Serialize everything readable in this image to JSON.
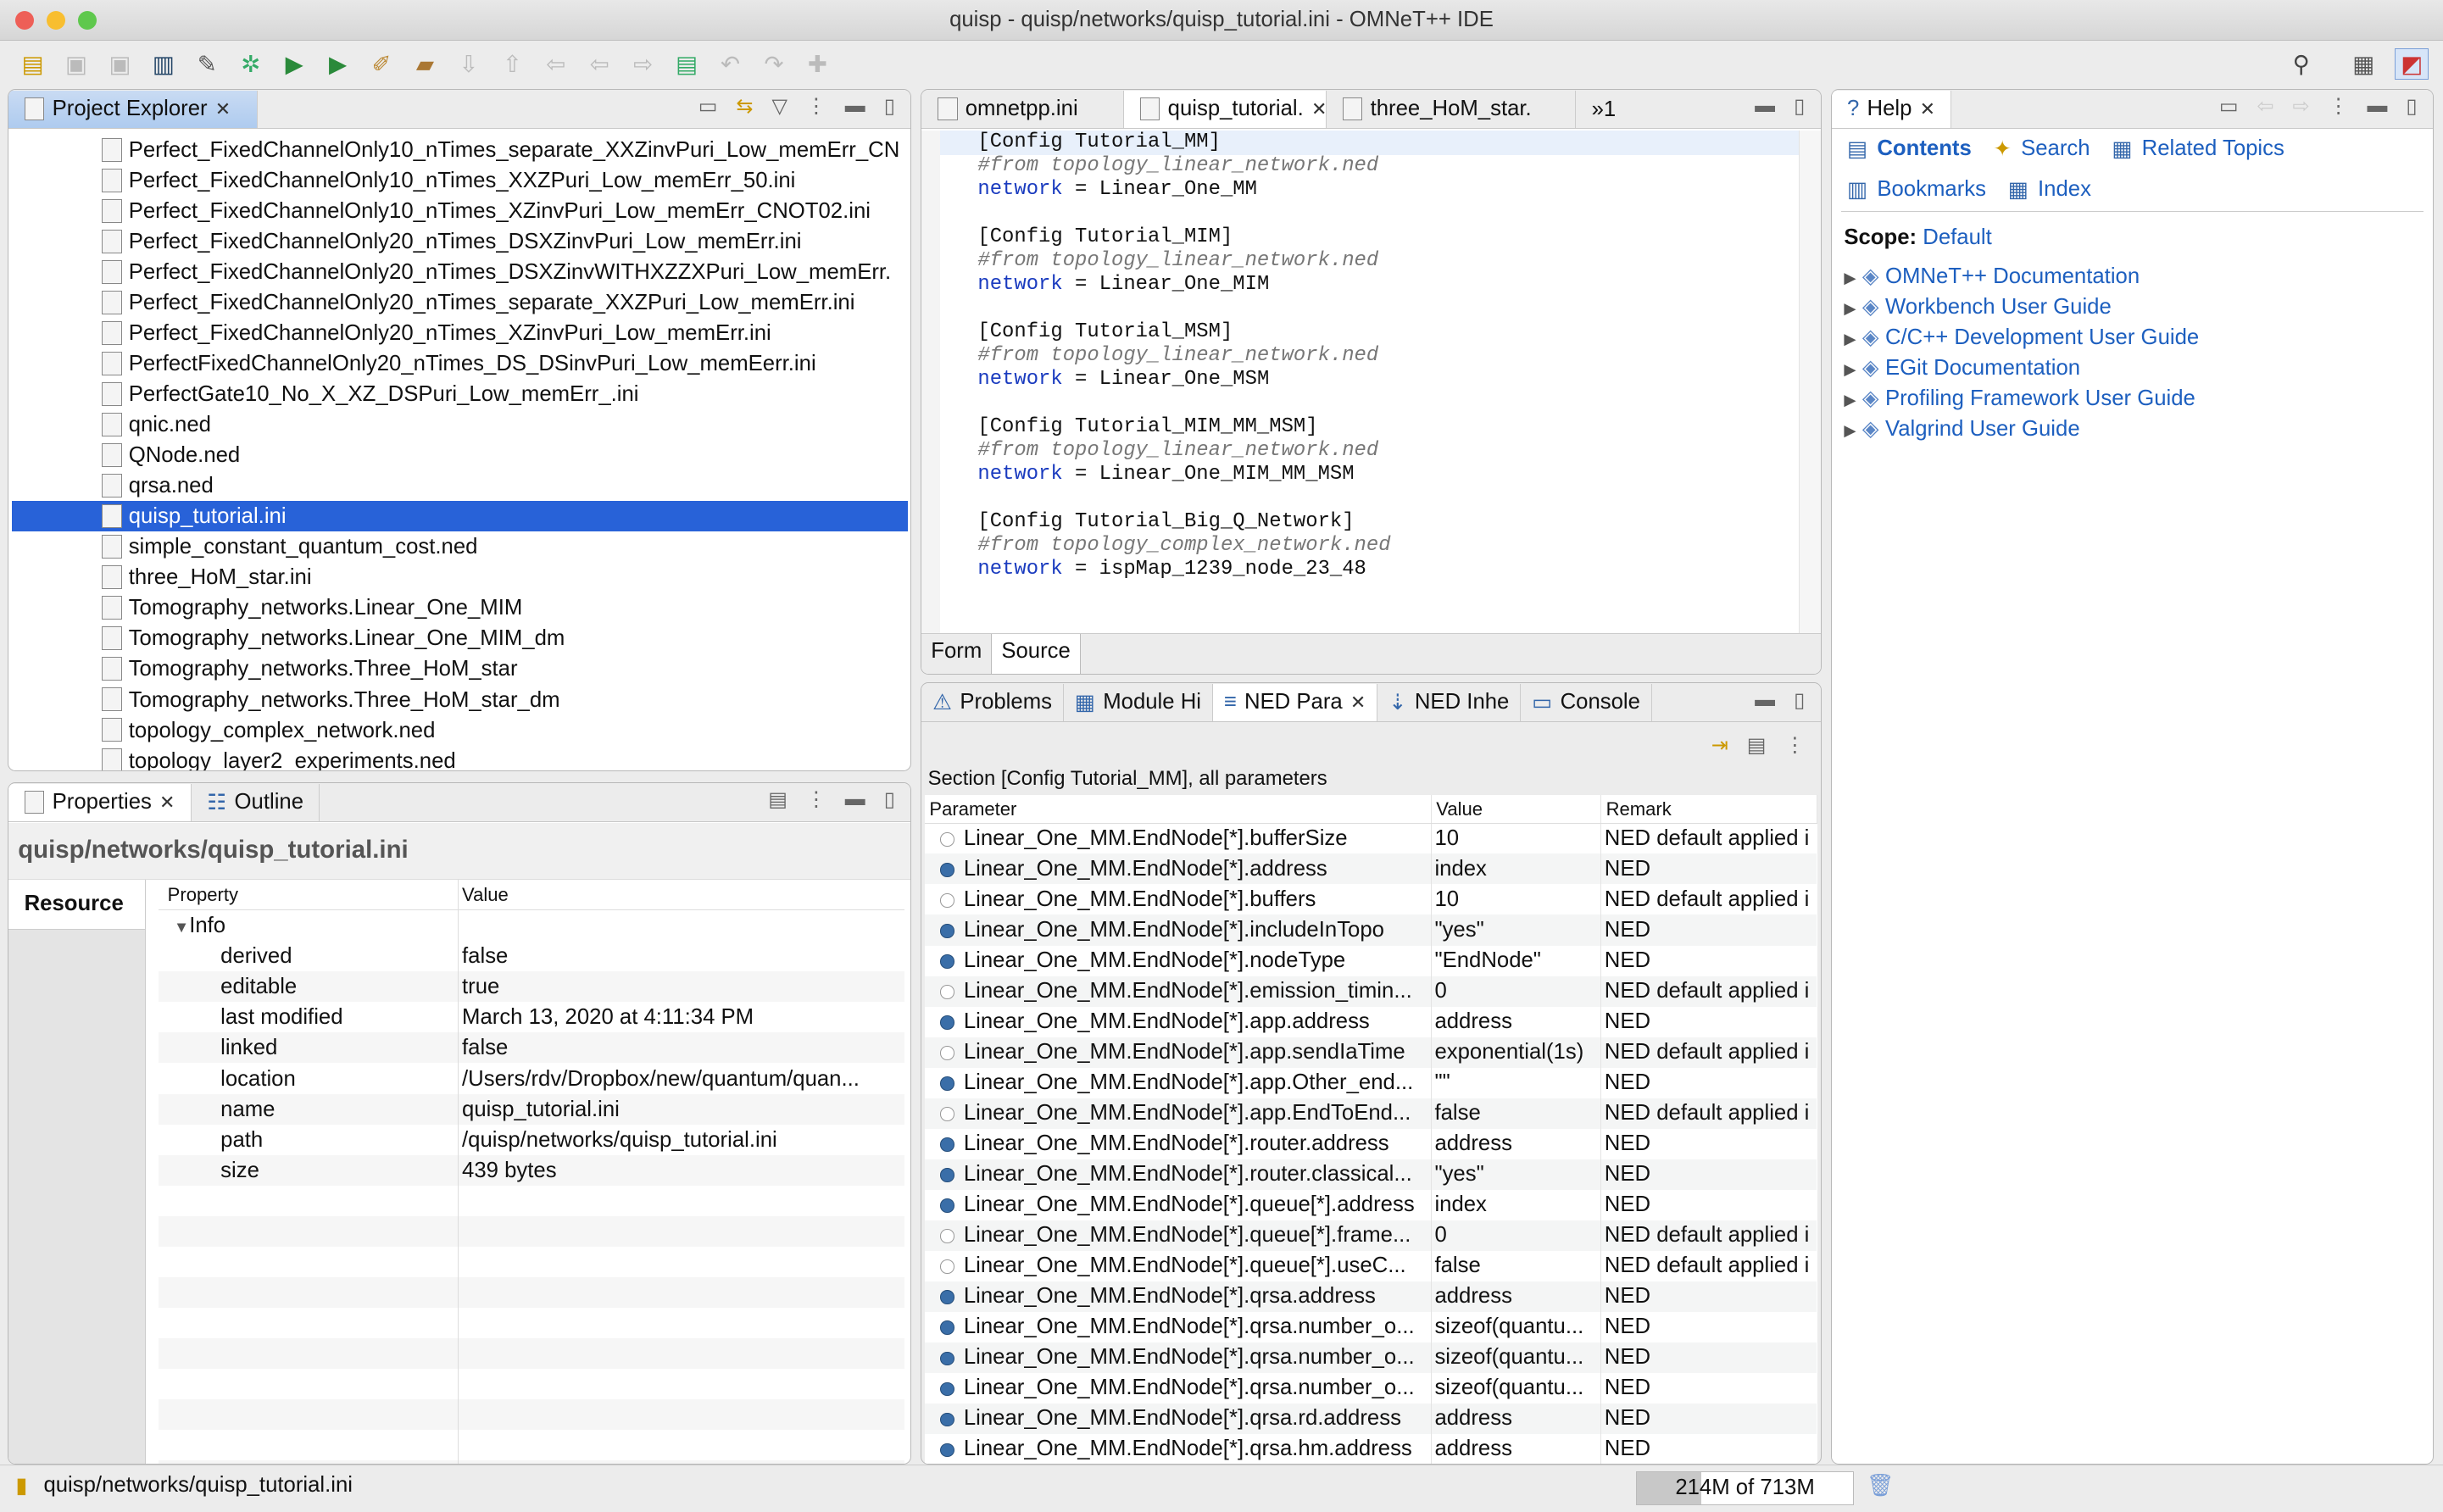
{
  "window": {
    "title": "quisp - quisp/networks/quisp_tutorial.ini - OMNeT++ IDE"
  },
  "project_explorer": {
    "tab": "Project Explorer",
    "items": [
      "Perfect_FixedChannelOnly10_nTimes_separate_XXZinvPuri_Low_memErr_CN",
      "Perfect_FixedChannelOnly10_nTimes_XXZPuri_Low_memErr_50.ini",
      "Perfect_FixedChannelOnly10_nTimes_XZinvPuri_Low_memErr_CNOT02.ini",
      "Perfect_FixedChannelOnly20_nTimes_DSXZinvPuri_Low_memErr.ini",
      "Perfect_FixedChannelOnly20_nTimes_DSXZinvWITHXZZXPuri_Low_memErr.",
      "Perfect_FixedChannelOnly20_nTimes_separate_XXZPuri_Low_memErr.ini",
      "Perfect_FixedChannelOnly20_nTimes_XZinvPuri_Low_memErr.ini",
      "PerfectFixedChannelOnly20_nTimes_DS_DSinvPuri_Low_memEerr.ini",
      "PerfectGate10_No_X_XZ_DSPuri_Low_memErr_.ini",
      "qnic.ned",
      "QNode.ned",
      "qrsa.ned",
      "quisp_tutorial.ini",
      "simple_constant_quantum_cost.ned",
      "three_HoM_star.ini",
      "Tomography_networks.Linear_One_MIM",
      "Tomography_networks.Linear_One_MIM_dm",
      "Tomography_networks.Three_HoM_star",
      "Tomography_networks.Three_HoM_star_dm",
      "topology_complex_network.ned",
      "topology_layer2_experiments.ned"
    ],
    "selected": "quisp_tutorial.ini"
  },
  "properties": {
    "tab": "Properties",
    "outline_tab": "Outline",
    "path_title": "quisp/networks/quisp_tutorial.ini",
    "side_tab": "Resource",
    "col_property": "Property",
    "col_value": "Value",
    "group": "Info",
    "rows": [
      [
        "derived",
        "false"
      ],
      [
        "editable",
        "true"
      ],
      [
        "last modified",
        "March 13, 2020 at 4:11:34 PM"
      ],
      [
        "linked",
        "false"
      ],
      [
        "location",
        "/Users/rdv/Dropbox/new/quantum/quan..."
      ],
      [
        "name",
        "quisp_tutorial.ini"
      ],
      [
        "path",
        "/quisp/networks/quisp_tutorial.ini"
      ],
      [
        "size",
        "439  bytes"
      ]
    ]
  },
  "editor": {
    "tabs": [
      "omnetpp.ini",
      "quisp_tutorial.",
      "three_HoM_star."
    ],
    "overflow": "»1",
    "bottom_tabs": [
      "Form",
      "Source"
    ],
    "lines": [
      {
        "t": "plain",
        "s": "[Config Tutorial_MM]"
      },
      {
        "t": "cm",
        "s": "#from topology_linear_network.ned"
      },
      {
        "t": "kv",
        "k": "network",
        "s": " = Linear_One_MM"
      },
      {
        "t": "plain",
        "s": ""
      },
      {
        "t": "plain",
        "s": "[Config Tutorial_MIM]"
      },
      {
        "t": "cm",
        "s": "#from topology_linear_network.ned"
      },
      {
        "t": "kv",
        "k": "network",
        "s": " = Linear_One_MIM"
      },
      {
        "t": "plain",
        "s": ""
      },
      {
        "t": "plain",
        "s": "[Config Tutorial_MSM]"
      },
      {
        "t": "cm",
        "s": "#from topology_linear_network.ned"
      },
      {
        "t": "kv",
        "k": "network",
        "s": " = Linear_One_MSM"
      },
      {
        "t": "plain",
        "s": ""
      },
      {
        "t": "plain",
        "s": "[Config Tutorial_MIM_MM_MSM]"
      },
      {
        "t": "cm",
        "s": "#from topology_linear_network.ned"
      },
      {
        "t": "kv",
        "k": "network",
        "s": " = Linear_One_MIM_MM_MSM"
      },
      {
        "t": "plain",
        "s": ""
      },
      {
        "t": "plain",
        "s": "[Config Tutorial_Big_Q_Network]"
      },
      {
        "t": "cm",
        "s": "#from topology_complex_network.ned"
      },
      {
        "t": "kv",
        "k": "network",
        "s": " = ispMap_1239_node_23_48"
      }
    ]
  },
  "bottom": {
    "tabs": [
      "Problems",
      "Module Hi",
      "NED Para",
      "NED Inhe",
      "Console"
    ],
    "active": "NED Para",
    "section": "Section [Config Tutorial_MM], all parameters",
    "headers": [
      "Parameter",
      "Value",
      "Remark"
    ],
    "rows": [
      [
        "Linear_One_MM.EndNode[*].bufferSize",
        "10",
        "NED default applied i",
        "def"
      ],
      [
        "Linear_One_MM.EndNode[*].address",
        "index",
        "NED",
        "ned"
      ],
      [
        "Linear_One_MM.EndNode[*].buffers",
        "10",
        "NED default applied i",
        "def"
      ],
      [
        "Linear_One_MM.EndNode[*].includeInTopo",
        "\"yes\"",
        "NED",
        "ned"
      ],
      [
        "Linear_One_MM.EndNode[*].nodeType",
        "\"EndNode\"",
        "NED",
        "ned"
      ],
      [
        "Linear_One_MM.EndNode[*].emission_timin...",
        "0",
        "NED default applied i",
        "def"
      ],
      [
        "Linear_One_MM.EndNode[*].app.address",
        "address",
        "NED",
        "ned"
      ],
      [
        "Linear_One_MM.EndNode[*].app.sendIaTime",
        "exponential(1s)",
        "NED default applied i",
        "def"
      ],
      [
        "Linear_One_MM.EndNode[*].app.Other_end...",
        "\"\"",
        "NED",
        "ned"
      ],
      [
        "Linear_One_MM.EndNode[*].app.EndToEnd...",
        "false",
        "NED default applied i",
        "def"
      ],
      [
        "Linear_One_MM.EndNode[*].router.address",
        "address",
        "NED",
        "ned"
      ],
      [
        "Linear_One_MM.EndNode[*].router.classical...",
        "\"yes\"",
        "NED",
        "ned"
      ],
      [
        "Linear_One_MM.EndNode[*].queue[*].address",
        "index",
        "NED",
        "ned"
      ],
      [
        "Linear_One_MM.EndNode[*].queue[*].frame...",
        "0",
        "NED default applied i",
        "def"
      ],
      [
        "Linear_One_MM.EndNode[*].queue[*].useC...",
        "false",
        "NED default applied i",
        "def"
      ],
      [
        "Linear_One_MM.EndNode[*].qrsa.address",
        "address",
        "NED",
        "ned"
      ],
      [
        "Linear_One_MM.EndNode[*].qrsa.number_o...",
        "sizeof(quantu...",
        "NED",
        "ned"
      ],
      [
        "Linear_One_MM.EndNode[*].qrsa.number_o...",
        "sizeof(quantu...",
        "NED",
        "ned"
      ],
      [
        "Linear_One_MM.EndNode[*].qrsa.number_o...",
        "sizeof(quantu...",
        "NED",
        "ned"
      ],
      [
        "Linear_One_MM.EndNode[*].qrsa.rd.address",
        "address",
        "NED",
        "ned"
      ],
      [
        "Linear_One_MM.EndNode[*].qrsa.hm.address",
        "address",
        "NED",
        "ned"
      ]
    ]
  },
  "help": {
    "tab": "Help",
    "links": [
      "Contents",
      "Search",
      "Related Topics",
      "Bookmarks",
      "Index"
    ],
    "scope_label": "Scope:",
    "scope_value": "Default",
    "books": [
      "OMNeT++ Documentation",
      "Workbench User Guide",
      "C/C++ Development User Guide",
      "EGit Documentation",
      "Profiling Framework User Guide",
      "Valgrind User Guide"
    ]
  },
  "status": {
    "path": "quisp/networks/quisp_tutorial.ini",
    "memory": "214M of 713M",
    "memory_used_fraction": 0.3
  },
  "colors": {
    "selection": "#2862d8",
    "active_tab": "#aecbef",
    "link": "#1d5fbf",
    "keyword": "#1a3bbf"
  }
}
